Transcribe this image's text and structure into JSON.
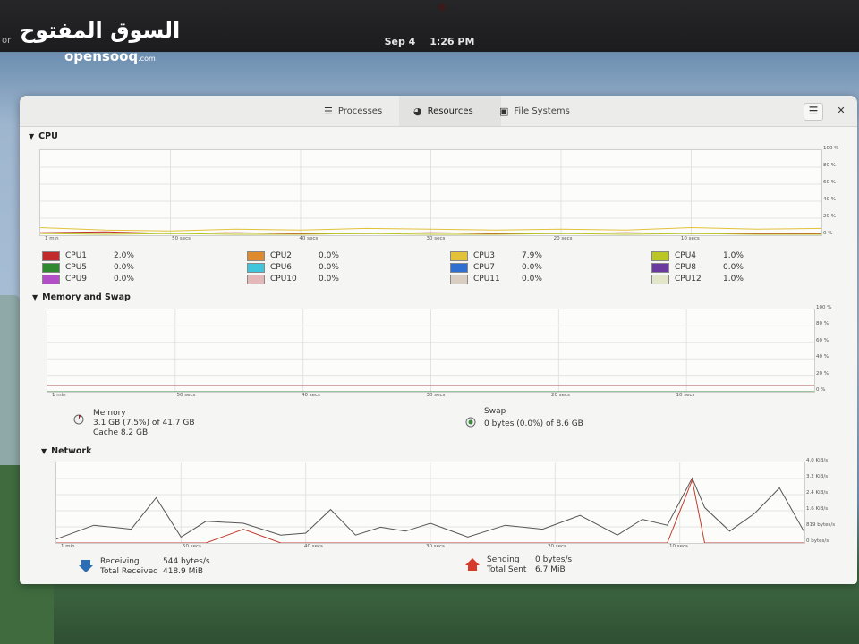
{
  "watermark": {
    "arabic": "السوق المفتوح",
    "latin": "opensooq",
    "suffix": ".com"
  },
  "topbar": {
    "left_fragment": "or",
    "date": "Sep 4",
    "time": "1:26 PM"
  },
  "header": {
    "tabs": [
      {
        "label": "Processes",
        "icon": "list-icon"
      },
      {
        "label": "Resources",
        "icon": "gauge-icon",
        "active": true
      },
      {
        "label": "File Systems",
        "icon": "disk-icon"
      }
    ],
    "menu_icon": "hamburger-icon",
    "close_icon": "close-icon"
  },
  "cpu": {
    "title": "CPU",
    "y_ticks": [
      "100 %",
      "80 %",
      "60 %",
      "40 %",
      "20 %",
      "0 %"
    ],
    "x_ticks": [
      "1 min",
      "50 secs",
      "40 secs",
      "30 secs",
      "20 secs",
      "10 secs"
    ],
    "items": [
      {
        "name": "CPU1",
        "value": "2.0%",
        "color": "#c22b2b"
      },
      {
        "name": "CPU2",
        "value": "0.0%",
        "color": "#e08a2e"
      },
      {
        "name": "CPU3",
        "value": "7.9%",
        "color": "#e2c23a"
      },
      {
        "name": "CPU4",
        "value": "1.0%",
        "color": "#b9c626"
      },
      {
        "name": "CPU5",
        "value": "0.0%",
        "color": "#2f8a2f"
      },
      {
        "name": "CPU6",
        "value": "0.0%",
        "color": "#40c6dc"
      },
      {
        "name": "CPU7",
        "value": "0.0%",
        "color": "#2f6fd0"
      },
      {
        "name": "CPU8",
        "value": "0.0%",
        "color": "#6a3a9e"
      },
      {
        "name": "CPU9",
        "value": "0.0%",
        "color": "#b34fc6"
      },
      {
        "name": "CPU10",
        "value": "0.0%",
        "color": "#e4b8b8"
      },
      {
        "name": "CPU11",
        "value": "0.0%",
        "color": "#d8cfc2"
      },
      {
        "name": "CPU12",
        "value": "1.0%",
        "color": "#e3e6c8"
      }
    ]
  },
  "memory": {
    "title": "Memory and Swap",
    "y_ticks": [
      "100 %",
      "80 %",
      "60 %",
      "40 %",
      "20 %",
      "0 %"
    ],
    "x_ticks": [
      "1 min",
      "50 secs",
      "40 secs",
      "30 secs",
      "20 secs",
      "10 secs"
    ],
    "memory_label": "Memory",
    "memory_usage": "3.1 GB (7.5%) of 41.7 GB",
    "memory_cache": "Cache 8.2 GB",
    "memory_fraction": 0.075,
    "swap_label": "Swap",
    "swap_usage": "0 bytes (0.0%) of 8.6 GB",
    "swap_fraction": 0.0
  },
  "network": {
    "title": "Network",
    "y_ticks": [
      "4.0 KiB/s",
      "3.2 KiB/s",
      "2.4 KiB/s",
      "1.6 KiB/s",
      "819 bytes/s",
      "0 bytes/s"
    ],
    "x_ticks": [
      "1 min",
      "50 secs",
      "40 secs",
      "30 secs",
      "20 secs",
      "10 secs"
    ],
    "receiving_label": "Receiving",
    "receiving_value": "544 bytes/s",
    "total_received_label": "Total Received",
    "total_received_value": "418.9 MiB",
    "sending_label": "Sending",
    "sending_value": "0 bytes/s",
    "total_sent_label": "Total Sent",
    "total_sent_value": "6.7 MiB"
  },
  "chart_data": [
    {
      "type": "line",
      "title": "CPU",
      "x": [
        60,
        55,
        50,
        45,
        40,
        35,
        30,
        25,
        20,
        15,
        10,
        5,
        0
      ],
      "ylim": [
        0,
        100
      ],
      "series": [
        {
          "name": "CPU1",
          "values": [
            3,
            4,
            2,
            3,
            2,
            2,
            3,
            2,
            2,
            3,
            2,
            2,
            2
          ]
        },
        {
          "name": "CPU3",
          "values": [
            9,
            6,
            5,
            7,
            6,
            8,
            7,
            6,
            7,
            6,
            9,
            7,
            8
          ]
        },
        {
          "name": "CPU4",
          "values": [
            2,
            1,
            2,
            1,
            1,
            2,
            1,
            1,
            2,
            1,
            2,
            1,
            1
          ]
        }
      ]
    },
    {
      "type": "line",
      "title": "Memory and Swap",
      "x": [
        60,
        0
      ],
      "ylim": [
        0,
        100
      ],
      "series": [
        {
          "name": "Memory",
          "values": [
            7.5,
            7.5
          ]
        },
        {
          "name": "Swap",
          "values": [
            0,
            0
          ]
        }
      ]
    },
    {
      "type": "line",
      "title": "Network",
      "x": [
        60,
        57,
        54,
        52,
        50,
        48,
        45,
        42,
        40,
        38,
        36,
        34,
        32,
        30,
        27,
        24,
        21,
        18,
        15,
        13,
        11,
        9,
        8,
        6,
        4,
        2,
        0
      ],
      "ylim": [
        0,
        4096
      ],
      "series": [
        {
          "name": "Receiving",
          "values": [
            200,
            900,
            700,
            2300,
            300,
            1100,
            1000,
            400,
            500,
            1700,
            400,
            800,
            600,
            1000,
            300,
            900,
            700,
            1400,
            400,
            1200,
            900,
            3300,
            1800,
            600,
            1500,
            2800,
            544
          ]
        },
        {
          "name": "Sending",
          "values": [
            0,
            0,
            0,
            0,
            0,
            0,
            700,
            0,
            0,
            0,
            0,
            0,
            0,
            0,
            0,
            0,
            0,
            0,
            0,
            0,
            0,
            3200,
            0,
            0,
            0,
            0,
            0
          ]
        }
      ]
    }
  ]
}
